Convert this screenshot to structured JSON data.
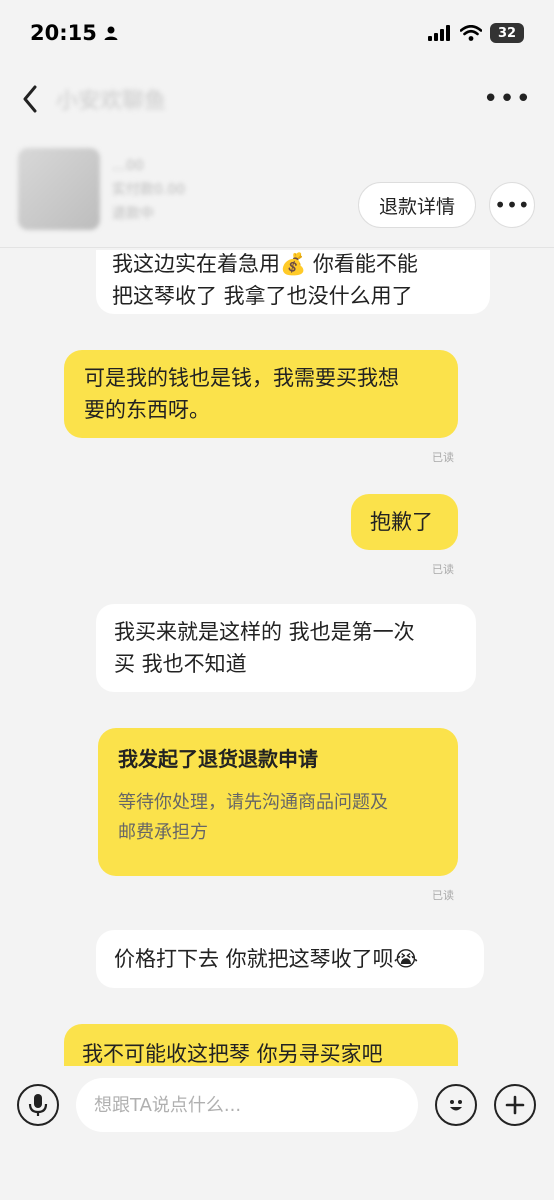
{
  "status": {
    "time": "20:15",
    "battery": "32"
  },
  "nav": {
    "title": "小安欢聊鱼"
  },
  "product": {
    "line1": "…00",
    "line2": "实付款0.00",
    "status": "退款中"
  },
  "actions": {
    "refund_detail": "退款详情"
  },
  "messages": [
    {
      "id": "m1",
      "side": "in",
      "lines": [
        "我这边实在着急用💰 你看能不能",
        "把这琴收了  我拿了也没什么用了"
      ]
    },
    {
      "id": "m2",
      "side": "out",
      "lines": [
        "可是我的钱也是钱，我需要买我想",
        "要的东西呀。"
      ],
      "read": "已读"
    },
    {
      "id": "m3",
      "side": "out",
      "lines": [
        "抱歉了"
      ],
      "read": "已读"
    },
    {
      "id": "m4",
      "side": "in",
      "lines": [
        "我买来就是这样的  我也是第一次",
        "买  我也不知道"
      ]
    },
    {
      "id": "m5",
      "side": "out",
      "card": true,
      "title": "我发起了退货退款申请",
      "sub_lines": [
        "等待你处理，请先沟通商品问题及",
        "邮费承担方"
      ],
      "read": "已读"
    },
    {
      "id": "m6",
      "side": "in",
      "lines": [
        "价格打下去  你就把这琴收了呗😭"
      ]
    },
    {
      "id": "m7",
      "side": "out",
      "lines": [
        "我不可能收这把琴 你另寻买家吧"
      ]
    }
  ],
  "input": {
    "placeholder": "想跟TA说点什么..."
  },
  "colors": {
    "outgoing_bubble": "#fbe24b",
    "incoming_bubble": "#ffffff",
    "background": "#f3f3f3"
  }
}
